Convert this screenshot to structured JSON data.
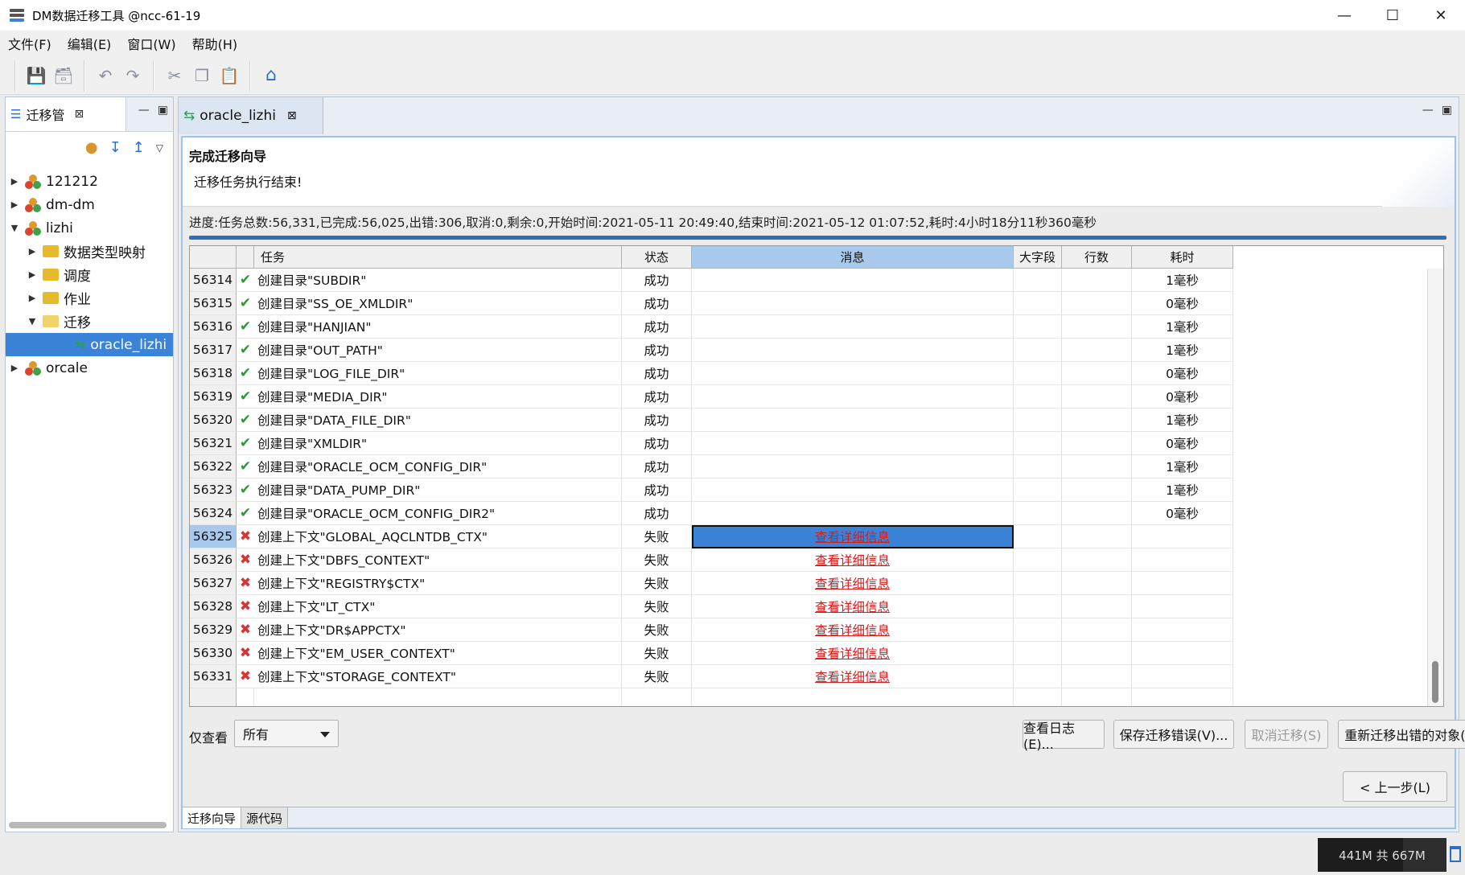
{
  "window": {
    "title": "DM数据迁移工具 @ncc-61-19",
    "minimize": "—",
    "maximize": "☐",
    "close": "✕"
  },
  "menu": [
    "文件(F)",
    "编辑(E)",
    "窗口(W)",
    "帮助(H)"
  ],
  "left_panel": {
    "tab_label": "迁移管",
    "tab_close": "⊠",
    "tree": [
      {
        "label": "121212",
        "type": "db",
        "level": 0,
        "expanded": false
      },
      {
        "label": "dm-dm",
        "type": "db",
        "level": 0,
        "expanded": false
      },
      {
        "label": "lizhi",
        "type": "db",
        "level": 0,
        "expanded": true
      },
      {
        "label": "数据类型映射",
        "type": "folder",
        "level": 1,
        "expanded": false
      },
      {
        "label": "调度",
        "type": "folder",
        "level": 1,
        "expanded": false
      },
      {
        "label": "作业",
        "type": "folder",
        "level": 1,
        "expanded": false
      },
      {
        "label": "迁移",
        "type": "folder-open",
        "level": 1,
        "expanded": true
      },
      {
        "label": "oracle_lizhi",
        "type": "migration",
        "level": 2,
        "selected": true
      },
      {
        "label": "orcale",
        "type": "db",
        "level": 0,
        "expanded": false
      }
    ]
  },
  "editor": {
    "tab_label": "oracle_lizhi",
    "tab_close": "⊠",
    "wizard_title": "完成迁移向导",
    "wizard_subtitle": "迁移任务执行结束!",
    "progress": {
      "text": "进度:任务总数:56,331,已完成:56,025,出错:306,取消:0,剩余:0,开始时间:2021-05-11 20:49:40,结束时间:2021-05-12 01:07:52,耗时:4小时18分11秒360毫秒",
      "fraction": 1.0
    },
    "columns": {
      "task": "任务",
      "status": "状态",
      "message": "消息",
      "lob": "大字段",
      "rows": "行数",
      "elapsed": "耗时"
    },
    "rows": [
      {
        "num": "56314",
        "ok": true,
        "task": "创建目录\"SUBDIR\"",
        "status": "成功",
        "message": "",
        "elapsed": "1毫秒"
      },
      {
        "num": "56315",
        "ok": true,
        "task": "创建目录\"SS_OE_XMLDIR\"",
        "status": "成功",
        "message": "",
        "elapsed": "0毫秒"
      },
      {
        "num": "56316",
        "ok": true,
        "task": "创建目录\"HANJIAN\"",
        "status": "成功",
        "message": "",
        "elapsed": "1毫秒"
      },
      {
        "num": "56317",
        "ok": true,
        "task": "创建目录\"OUT_PATH\"",
        "status": "成功",
        "message": "",
        "elapsed": "1毫秒"
      },
      {
        "num": "56318",
        "ok": true,
        "task": "创建目录\"LOG_FILE_DIR\"",
        "status": "成功",
        "message": "",
        "elapsed": "0毫秒"
      },
      {
        "num": "56319",
        "ok": true,
        "task": "创建目录\"MEDIA_DIR\"",
        "status": "成功",
        "message": "",
        "elapsed": "0毫秒"
      },
      {
        "num": "56320",
        "ok": true,
        "task": "创建目录\"DATA_FILE_DIR\"",
        "status": "成功",
        "message": "",
        "elapsed": "1毫秒"
      },
      {
        "num": "56321",
        "ok": true,
        "task": "创建目录\"XMLDIR\"",
        "status": "成功",
        "message": "",
        "elapsed": "0毫秒"
      },
      {
        "num": "56322",
        "ok": true,
        "task": "创建目录\"ORACLE_OCM_CONFIG_DIR\"",
        "status": "成功",
        "message": "",
        "elapsed": "1毫秒"
      },
      {
        "num": "56323",
        "ok": true,
        "task": "创建目录\"DATA_PUMP_DIR\"",
        "status": "成功",
        "message": "",
        "elapsed": "1毫秒"
      },
      {
        "num": "56324",
        "ok": true,
        "task": "创建目录\"ORACLE_OCM_CONFIG_DIR2\"",
        "status": "成功",
        "message": "",
        "elapsed": "0毫秒"
      },
      {
        "num": "56325",
        "ok": false,
        "task": "创建上下文\"GLOBAL_AQCLNTDB_CTX\"",
        "status": "失败",
        "message": "查看详细信息",
        "elapsed": "",
        "selected": true
      },
      {
        "num": "56326",
        "ok": false,
        "task": "创建上下文\"DBFS_CONTEXT\"",
        "status": "失败",
        "message": "查看详细信息",
        "elapsed": ""
      },
      {
        "num": "56327",
        "ok": false,
        "task": "创建上下文\"REGISTRY$CTX\"",
        "status": "失败",
        "message": "查看详细信息",
        "elapsed": ""
      },
      {
        "num": "56328",
        "ok": false,
        "task": "创建上下文\"LT_CTX\"",
        "status": "失败",
        "message": "查看详细信息",
        "elapsed": ""
      },
      {
        "num": "56329",
        "ok": false,
        "task": "创建上下文\"DR$APPCTX\"",
        "status": "失败",
        "message": "查看详细信息",
        "elapsed": ""
      },
      {
        "num": "56330",
        "ok": false,
        "task": "创建上下文\"EM_USER_CONTEXT\"",
        "status": "失败",
        "message": "查看详细信息",
        "elapsed": ""
      },
      {
        "num": "56331",
        "ok": false,
        "task": "创建上下文\"STORAGE_CONTEXT\"",
        "status": "失败",
        "message": "查看详细信息",
        "elapsed": ""
      }
    ],
    "filter_label": "仅查看",
    "filter_value": "所有",
    "buttons": {
      "view_log": "查看日志(E)...",
      "save_errors": "保存迁移错误(V)...",
      "cancel_migration": "取消迁移(S)",
      "remigrate": "重新迁移出错的对象(R)",
      "prev": "< 上一步(L)"
    },
    "bottom_tabs": [
      "迁移向导",
      "源代码"
    ]
  },
  "status_bar": {
    "memory": "441M 共 667M",
    "memory_used_fraction": 0.66
  },
  "colors": {
    "selection": "#3b83d6",
    "success": "#2b9a36",
    "error": "#d53535",
    "link": "#d41f1f"
  }
}
